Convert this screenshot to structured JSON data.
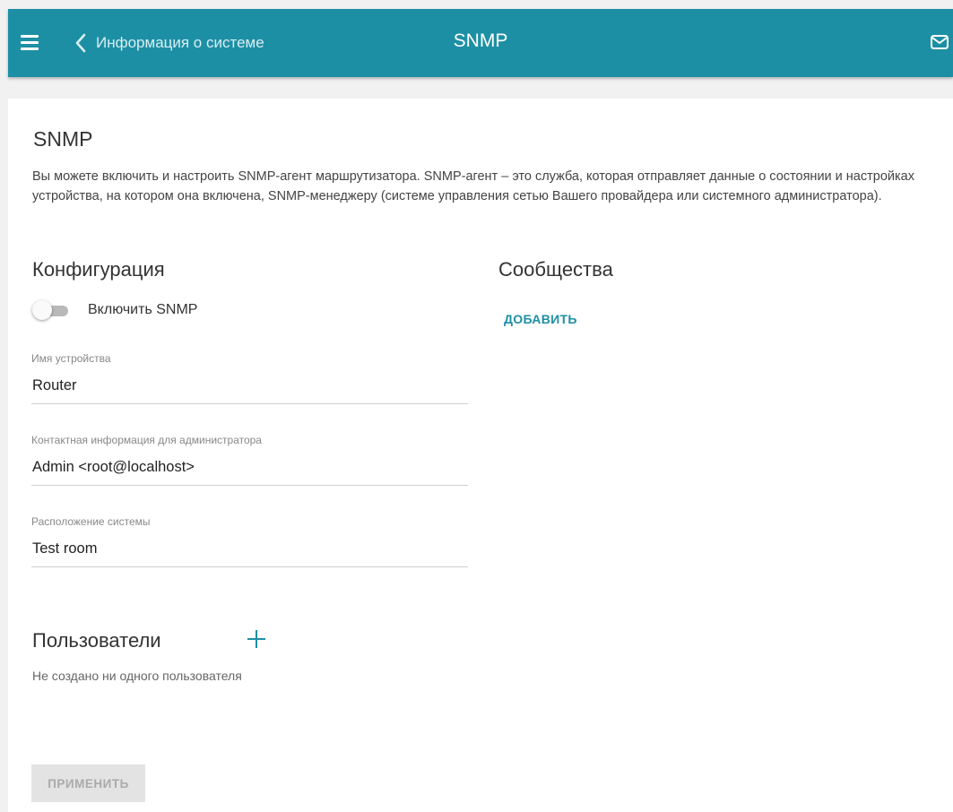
{
  "header": {
    "menu_icon": "hamburger-menu-icon",
    "back_icon": "chevron-left-icon",
    "back_label": "Информация о системе",
    "title": "SNMP",
    "mail_icon": "mail-envelope-icon",
    "bar_color": "#1d8fa4"
  },
  "main": {
    "title": "SNMP",
    "description": "Вы можете включить и настроить SNMP-агент маршрутизатора. SNMP-агент – это служба, которая отправляет данные о состоянии и настройках устройства, на котором она включена, SNMP-менеджеру (системе управления сетью Вашего провайдера или системного администратора).",
    "configuration": {
      "title": "Конфигурация",
      "enable_label": "Включить SNMP",
      "enable_state": false,
      "fields": [
        {
          "label": "Имя устройства",
          "value": "Router"
        },
        {
          "label": "Контактная информация для администратора",
          "value": "Admin <root@localhost>"
        },
        {
          "label": "Расположение системы",
          "value": "Test room"
        }
      ]
    },
    "communities": {
      "title": "Сообщества",
      "add_label": "ДОБАВИТЬ"
    },
    "users": {
      "title": "Пользователи",
      "add_icon": "plus-icon",
      "empty_text": "Не создано ни одного пользователя"
    },
    "apply_label": "ПРИМЕНИТЬ"
  },
  "colors": {
    "accent": "#1d8fa4",
    "background": "#f1f1f1",
    "card": "#ffffff",
    "disabled_button": "#e3e3e3"
  }
}
